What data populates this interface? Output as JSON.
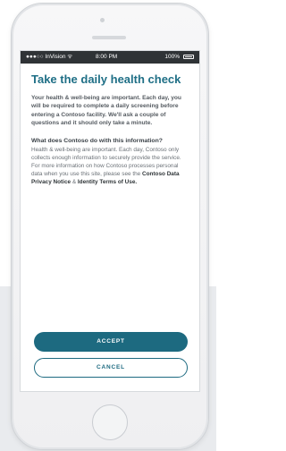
{
  "status_bar": {
    "carrier": "●●●○○ InVision ᯤ",
    "time": "8:00 PM",
    "battery": "100%"
  },
  "main": {
    "title": "Take the daily health check",
    "intro": "Your health & well-being are important. Each day, you will be required to complete a daily screening before entering a Contoso facility. We'll ask a couple of questions and it should only take a minute.",
    "question": "What does Contoso do with this information?",
    "answer_text": "Health & well-being are important. Each day, Contoso only collects enough information to securely provide the service. For more information on how Contoso processes personal data when you use this site, please see the ",
    "privacy_link": "Contoso Data Privacy Notice",
    "ampersand": " & ",
    "terms_link": "Identity Terms of Use.",
    "accept_label": "ACCEPT",
    "cancel_label": "CANCEL"
  },
  "colors": {
    "accent": "#1d6a80",
    "title": "#1f6f86",
    "status_bar": "#2f3336"
  },
  "icons": {
    "wifi": "wifi-icon",
    "battery": "battery-icon"
  }
}
